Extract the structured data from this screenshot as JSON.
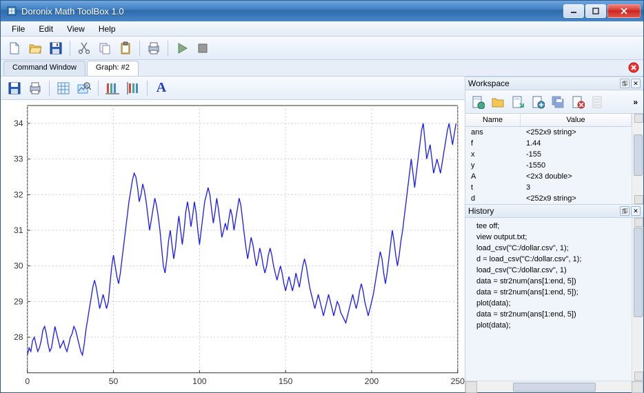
{
  "window": {
    "title": "Doronix Math ToolBox 1.0"
  },
  "menu": {
    "file": "File",
    "edit": "Edit",
    "view": "View",
    "help": "Help"
  },
  "tabs": {
    "cmd": "Command Window",
    "graph": "Graph: #2"
  },
  "panels": {
    "workspace": "Workspace",
    "history": "History"
  },
  "workspace": {
    "col_name": "Name",
    "col_value": "Value",
    "vars": [
      {
        "name": "ans",
        "value": "<252x9 string>"
      },
      {
        "name": "f",
        "value": "1.44"
      },
      {
        "name": "x",
        "value": "-155"
      },
      {
        "name": "y",
        "value": "-1550"
      },
      {
        "name": "A",
        "value": "<2x3 double>"
      },
      {
        "name": "t",
        "value": "3"
      },
      {
        "name": "d",
        "value": "<252x9 string>"
      }
    ]
  },
  "history": {
    "lines": [
      "tee off;",
      "view output.txt;",
      "load_csv(\"C:/dollar.csv\", 1);",
      "d = load_csv(\"C:/dollar.csv\", 1);",
      "load_csv(\"C:/dollar.csv\", 1)",
      "data = str2num(ans[1:end, 5])",
      "data = str2num(ans[1:end, 5]);",
      "plot(data);",
      "data = str2num(ans[1:end, 5])",
      "plot(data);"
    ]
  },
  "chart_data": {
    "type": "line",
    "title": "",
    "xlabel": "",
    "ylabel": "",
    "xlim": [
      0,
      250
    ],
    "ylim": [
      27,
      34.5
    ],
    "xticks": [
      0,
      50,
      100,
      150,
      200,
      250
    ],
    "yticks": [
      28,
      29,
      30,
      31,
      32,
      33,
      34
    ],
    "series": [
      {
        "name": "data",
        "color": "#1a1aff",
        "x_step": 1,
        "values": [
          27.5,
          27.7,
          27.6,
          27.9,
          28.0,
          27.8,
          27.6,
          27.7,
          27.9,
          28.2,
          28.3,
          28.1,
          27.8,
          27.6,
          27.7,
          28.0,
          28.3,
          28.1,
          27.9,
          27.7,
          27.8,
          27.9,
          27.7,
          27.6,
          27.8,
          28.0,
          28.1,
          28.3,
          28.2,
          28.0,
          27.8,
          27.6,
          27.5,
          27.8,
          28.2,
          28.5,
          28.8,
          29.1,
          29.4,
          29.6,
          29.4,
          29.1,
          28.8,
          29.0,
          29.2,
          29.0,
          28.8,
          29.0,
          29.5,
          30.0,
          30.3,
          30.0,
          29.7,
          29.5,
          29.8,
          30.2,
          30.6,
          31.0,
          31.4,
          31.8,
          32.1,
          32.4,
          32.6,
          32.5,
          32.2,
          31.8,
          32.0,
          32.3,
          32.1,
          31.8,
          31.4,
          31.0,
          31.3,
          31.6,
          31.9,
          31.7,
          31.4,
          31.0,
          30.5,
          30.0,
          29.8,
          30.2,
          30.7,
          31.0,
          30.6,
          30.2,
          30.5,
          31.0,
          31.4,
          31.0,
          30.6,
          31.0,
          31.5,
          31.8,
          31.5,
          31.1,
          31.4,
          31.8,
          31.5,
          31.0,
          30.6,
          31.0,
          31.4,
          31.8,
          32.0,
          32.2,
          32.0,
          31.6,
          31.2,
          31.5,
          31.9,
          31.6,
          31.2,
          30.8,
          31.0,
          31.2,
          31.0,
          31.3,
          31.6,
          31.4,
          31.0,
          31.3,
          31.6,
          31.9,
          31.7,
          31.3,
          30.9,
          30.5,
          30.2,
          30.5,
          30.8,
          30.6,
          30.3,
          30.0,
          30.2,
          30.5,
          30.3,
          30.0,
          29.8,
          30.0,
          30.3,
          30.5,
          30.3,
          30.0,
          29.8,
          29.6,
          29.8,
          30.0,
          29.8,
          29.5,
          29.3,
          29.5,
          29.7,
          29.5,
          29.3,
          29.5,
          29.8,
          29.6,
          29.4,
          29.7,
          30.0,
          30.2,
          30.0,
          29.7,
          29.4,
          29.2,
          29.0,
          28.8,
          29.0,
          29.2,
          29.0,
          28.8,
          28.6,
          28.8,
          29.0,
          29.2,
          29.0,
          28.8,
          28.6,
          28.8,
          29.0,
          28.9,
          28.7,
          28.6,
          28.5,
          28.4,
          28.6,
          28.8,
          29.0,
          29.2,
          29.0,
          28.8,
          29.0,
          29.3,
          29.5,
          29.3,
          29.0,
          28.8,
          28.6,
          28.8,
          29.0,
          29.2,
          29.5,
          29.8,
          30.1,
          30.4,
          30.2,
          29.8,
          29.5,
          29.8,
          30.2,
          30.6,
          31.0,
          30.7,
          30.3,
          30.0,
          30.3,
          30.7,
          31.0,
          31.4,
          31.8,
          32.2,
          32.6,
          33.0,
          32.6,
          32.2,
          32.6,
          33.0,
          33.4,
          33.8,
          34.0,
          33.5,
          33.0,
          33.2,
          33.4,
          33.0,
          32.6,
          32.8,
          33.0,
          32.8,
          32.6,
          32.9,
          33.2,
          33.5,
          33.8,
          34.0,
          33.7,
          33.4,
          33.7,
          34.0
        ]
      }
    ]
  }
}
